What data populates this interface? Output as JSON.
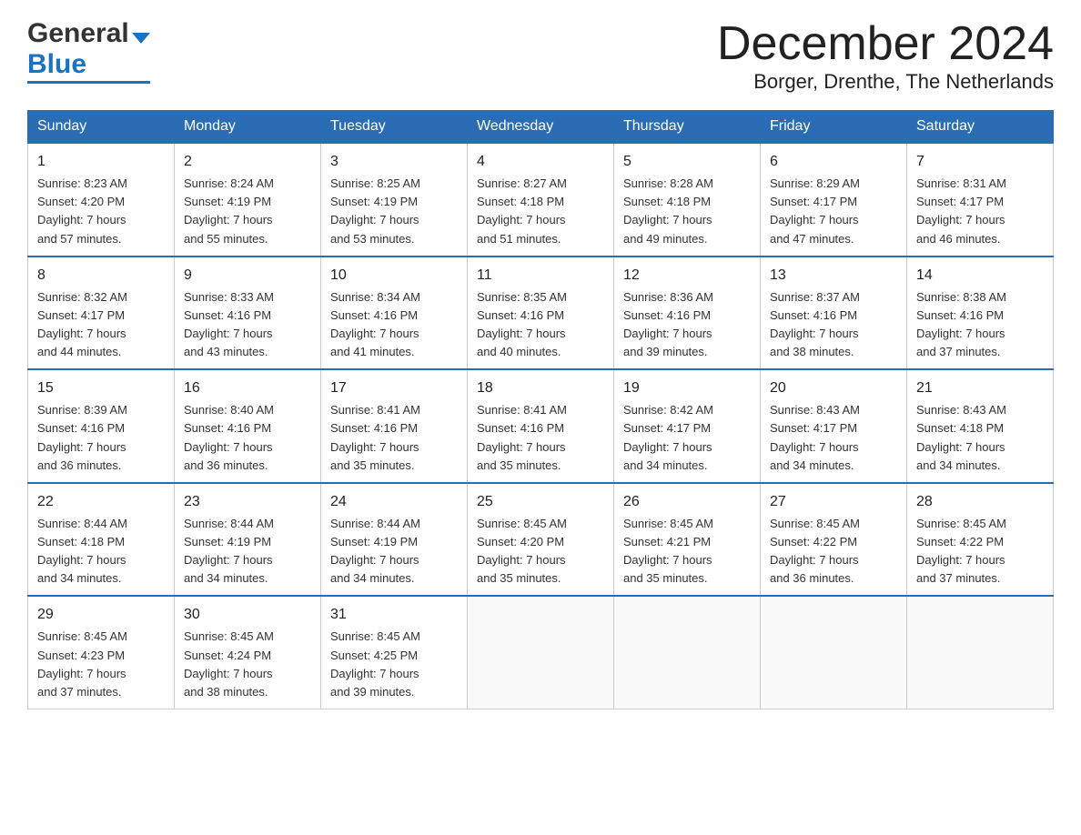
{
  "header": {
    "logo_general": "General",
    "logo_blue": "Blue",
    "month_title": "December 2024",
    "location": "Borger, Drenthe, The Netherlands"
  },
  "days_of_week": [
    "Sunday",
    "Monday",
    "Tuesday",
    "Wednesday",
    "Thursday",
    "Friday",
    "Saturday"
  ],
  "weeks": [
    [
      {
        "day": "1",
        "sunrise": "8:23 AM",
        "sunset": "4:20 PM",
        "daylight": "7 hours and 57 minutes."
      },
      {
        "day": "2",
        "sunrise": "8:24 AM",
        "sunset": "4:19 PM",
        "daylight": "7 hours and 55 minutes."
      },
      {
        "day": "3",
        "sunrise": "8:25 AM",
        "sunset": "4:19 PM",
        "daylight": "7 hours and 53 minutes."
      },
      {
        "day": "4",
        "sunrise": "8:27 AM",
        "sunset": "4:18 PM",
        "daylight": "7 hours and 51 minutes."
      },
      {
        "day": "5",
        "sunrise": "8:28 AM",
        "sunset": "4:18 PM",
        "daylight": "7 hours and 49 minutes."
      },
      {
        "day": "6",
        "sunrise": "8:29 AM",
        "sunset": "4:17 PM",
        "daylight": "7 hours and 47 minutes."
      },
      {
        "day": "7",
        "sunrise": "8:31 AM",
        "sunset": "4:17 PM",
        "daylight": "7 hours and 46 minutes."
      }
    ],
    [
      {
        "day": "8",
        "sunrise": "8:32 AM",
        "sunset": "4:17 PM",
        "daylight": "7 hours and 44 minutes."
      },
      {
        "day": "9",
        "sunrise": "8:33 AM",
        "sunset": "4:16 PM",
        "daylight": "7 hours and 43 minutes."
      },
      {
        "day": "10",
        "sunrise": "8:34 AM",
        "sunset": "4:16 PM",
        "daylight": "7 hours and 41 minutes."
      },
      {
        "day": "11",
        "sunrise": "8:35 AM",
        "sunset": "4:16 PM",
        "daylight": "7 hours and 40 minutes."
      },
      {
        "day": "12",
        "sunrise": "8:36 AM",
        "sunset": "4:16 PM",
        "daylight": "7 hours and 39 minutes."
      },
      {
        "day": "13",
        "sunrise": "8:37 AM",
        "sunset": "4:16 PM",
        "daylight": "7 hours and 38 minutes."
      },
      {
        "day": "14",
        "sunrise": "8:38 AM",
        "sunset": "4:16 PM",
        "daylight": "7 hours and 37 minutes."
      }
    ],
    [
      {
        "day": "15",
        "sunrise": "8:39 AM",
        "sunset": "4:16 PM",
        "daylight": "7 hours and 36 minutes."
      },
      {
        "day": "16",
        "sunrise": "8:40 AM",
        "sunset": "4:16 PM",
        "daylight": "7 hours and 36 minutes."
      },
      {
        "day": "17",
        "sunrise": "8:41 AM",
        "sunset": "4:16 PM",
        "daylight": "7 hours and 35 minutes."
      },
      {
        "day": "18",
        "sunrise": "8:41 AM",
        "sunset": "4:16 PM",
        "daylight": "7 hours and 35 minutes."
      },
      {
        "day": "19",
        "sunrise": "8:42 AM",
        "sunset": "4:17 PM",
        "daylight": "7 hours and 34 minutes."
      },
      {
        "day": "20",
        "sunrise": "8:43 AM",
        "sunset": "4:17 PM",
        "daylight": "7 hours and 34 minutes."
      },
      {
        "day": "21",
        "sunrise": "8:43 AM",
        "sunset": "4:18 PM",
        "daylight": "7 hours and 34 minutes."
      }
    ],
    [
      {
        "day": "22",
        "sunrise": "8:44 AM",
        "sunset": "4:18 PM",
        "daylight": "7 hours and 34 minutes."
      },
      {
        "day": "23",
        "sunrise": "8:44 AM",
        "sunset": "4:19 PM",
        "daylight": "7 hours and 34 minutes."
      },
      {
        "day": "24",
        "sunrise": "8:44 AM",
        "sunset": "4:19 PM",
        "daylight": "7 hours and 34 minutes."
      },
      {
        "day": "25",
        "sunrise": "8:45 AM",
        "sunset": "4:20 PM",
        "daylight": "7 hours and 35 minutes."
      },
      {
        "day": "26",
        "sunrise": "8:45 AM",
        "sunset": "4:21 PM",
        "daylight": "7 hours and 35 minutes."
      },
      {
        "day": "27",
        "sunrise": "8:45 AM",
        "sunset": "4:22 PM",
        "daylight": "7 hours and 36 minutes."
      },
      {
        "day": "28",
        "sunrise": "8:45 AM",
        "sunset": "4:22 PM",
        "daylight": "7 hours and 37 minutes."
      }
    ],
    [
      {
        "day": "29",
        "sunrise": "8:45 AM",
        "sunset": "4:23 PM",
        "daylight": "7 hours and 37 minutes."
      },
      {
        "day": "30",
        "sunrise": "8:45 AM",
        "sunset": "4:24 PM",
        "daylight": "7 hours and 38 minutes."
      },
      {
        "day": "31",
        "sunrise": "8:45 AM",
        "sunset": "4:25 PM",
        "daylight": "7 hours and 39 minutes."
      },
      null,
      null,
      null,
      null
    ]
  ],
  "labels": {
    "sunrise": "Sunrise:",
    "sunset": "Sunset:",
    "daylight": "Daylight:"
  }
}
